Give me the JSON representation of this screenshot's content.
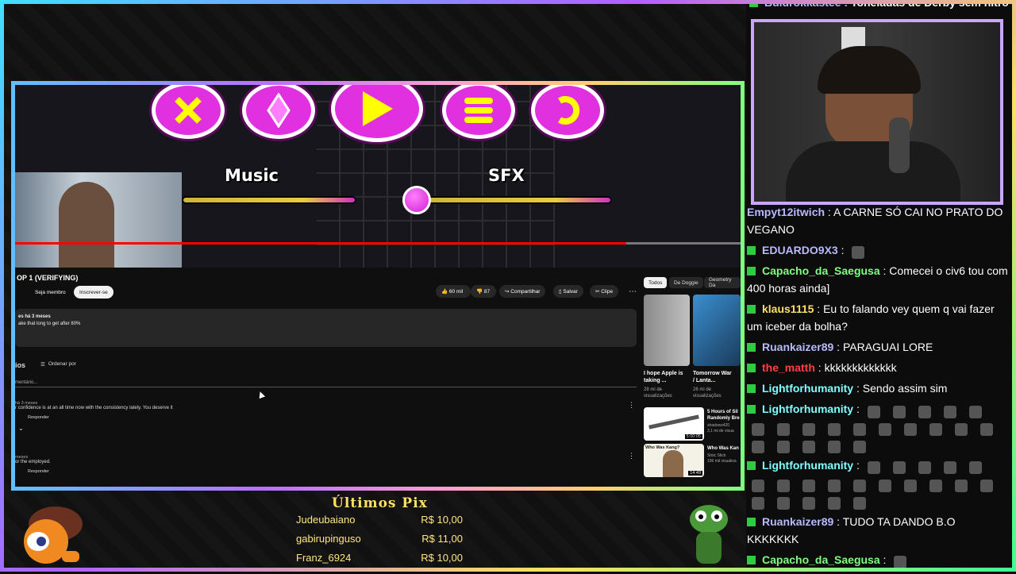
{
  "topline": {
    "name": "Buldrokkastee",
    "text": "Toneladas de Derby sem nitro"
  },
  "game": {
    "music_label": "Music",
    "sfx_label": "SFX"
  },
  "youtube": {
    "title": "OP 1 (VERIFYING)",
    "join_label": "Seja membro",
    "subscribe_label": "Inscrever-se",
    "likes": "60 mil",
    "dislikes": "87",
    "share_label": "Compartilhar",
    "save_label": "Salvar",
    "clip_label": "Clipe",
    "more_icon": "more-vert-icon",
    "desc_line1": "es  há 3 meses",
    "desc_line2": "ake that long to get after 80%",
    "comments_title": "ios",
    "sort_label": "Ordenar por",
    "add_comment_placeholder": "mentário...",
    "comments": [
      {
        "meta": "há 3 meses",
        "text": "r confidence is at an all time now with the consistency lately. You deserve it",
        "reply": "Responder"
      },
      {
        "meta": "meses",
        "text": "or the employed.",
        "reply": "Responder"
      }
    ],
    "chips": [
      "Todos",
      "De Doggie",
      "Geometry Da"
    ],
    "related": [
      {
        "title": "I hope Apple is taking ...",
        "meta1": "28 mi de",
        "meta2": "visualizações"
      },
      {
        "title": "Tomorrow War / Lanta...",
        "meta1": "26 mi de",
        "meta2": "visualizações"
      },
      {
        "title": "5 Hours of Sil Randomly Bre",
        "meta1": "shadowx420",
        "meta2": "3,1 mi de visua",
        "duration": "5:00:05"
      },
      {
        "title": "Who Was Kan",
        "meta1": "Stoic Stick",
        "meta2": "196 mil visualiza",
        "duration": "14:49",
        "thumb_text": "Who Was Kang?"
      }
    ]
  },
  "chat": [
    {
      "user": "Empyt12itwich",
      "color": "#b9b9ff",
      "badge": "",
      "text": "A CARNE SÓ CAI NO PRATO DO VEGANO"
    },
    {
      "user": "EDUARDO9X3",
      "color": "#b9b9ff",
      "badge": "green",
      "text": "",
      "emotes": 1
    },
    {
      "user": "Capacho_da_Saegusa",
      "color": "#7fff7f",
      "badge": "green2",
      "text": "Comecei o civ6 tou com 400 horas ainda]"
    },
    {
      "user": "klaus1115",
      "color": "#ffe066",
      "badge": "green2",
      "text": "Eu to falando vey quem q vai fazer um iceber da bolha?"
    },
    {
      "user": "Ruankaizer89",
      "color": "#b9b9ff",
      "badge": "green",
      "text": "PARAGUAI LORE"
    },
    {
      "user": "the_matth",
      "color": "#ff4040",
      "badge": "green",
      "text": "kkkkkkkkkkkkk"
    },
    {
      "user": "Lightforhumanity",
      "color": "#7fffff",
      "badge": "green",
      "text": "Sendo assim sim"
    },
    {
      "user": "Lightforhumanity",
      "color": "#7fffff",
      "badge": "green",
      "text": "",
      "emotes": 20
    },
    {
      "user": "Lightforhumanity",
      "color": "#7fffff",
      "badge": "green",
      "text": "",
      "emotes": 20
    },
    {
      "user": "Ruankaizer89",
      "color": "#b9b9ff",
      "badge": "green",
      "text": "TUDO TA DANDO B.O KKKKKKK"
    },
    {
      "user": "Capacho_da_Saegusa",
      "color": "#7fff7f",
      "badge": "green",
      "text": "",
      "emotes": 1
    }
  ],
  "pix": {
    "title": "Últimos Pix",
    "entries": [
      {
        "name": "Judeubaiano",
        "amount": "R$ 10,00"
      },
      {
        "name": "gabirupinguso",
        "amount": "R$ 11,00"
      },
      {
        "name": "Franz_6924",
        "amount": "R$ 10,00"
      }
    ]
  }
}
